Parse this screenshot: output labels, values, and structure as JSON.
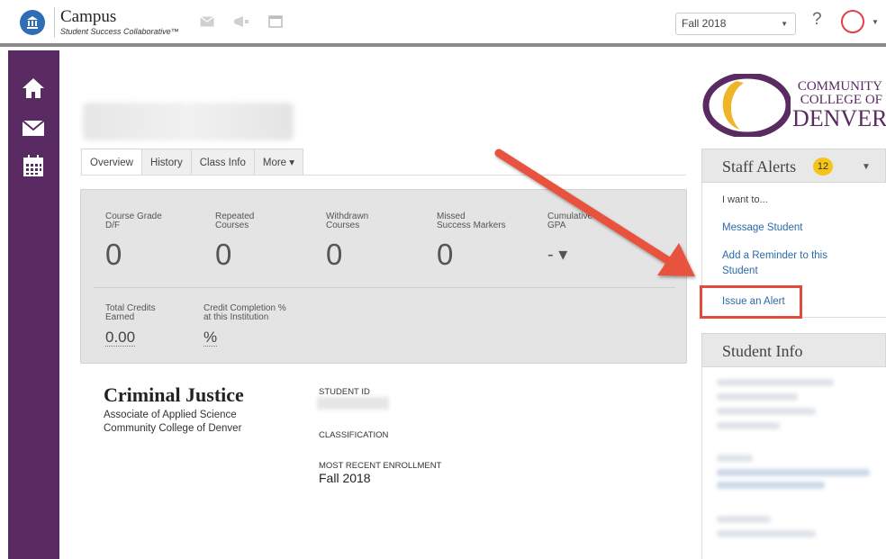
{
  "header": {
    "brand_title": "Campus",
    "brand_subtitle": "Student Success Collaborative™",
    "term_select_value": "Fall 2018",
    "help_label": "?"
  },
  "sidebar": {
    "items": [
      {
        "icon": "home-icon"
      },
      {
        "icon": "mail-icon"
      },
      {
        "icon": "calendar-icon"
      }
    ]
  },
  "tabs": [
    {
      "label": "Overview",
      "active": true
    },
    {
      "label": "History",
      "active": false
    },
    {
      "label": "Class Info",
      "active": false
    },
    {
      "label": "More ▾",
      "active": false
    }
  ],
  "stats": {
    "row1": [
      {
        "label": "Course Grade\nD/F",
        "value": "0"
      },
      {
        "label": "Repeated\nCourses",
        "value": "0"
      },
      {
        "label": "Withdrawn\nCourses",
        "value": "0"
      },
      {
        "label": "Missed\nSuccess Markers",
        "value": "0"
      },
      {
        "label": "Cumulative\nGPA",
        "value": "- ▾"
      }
    ],
    "row2": [
      {
        "label": "Total Credits\nEarned",
        "value": "0.00"
      },
      {
        "label": "Credit Completion %\nat this Institution",
        "value": "%"
      }
    ]
  },
  "program": {
    "title": "Criminal Justice",
    "degree": "Associate of Applied Science",
    "school": "Community College of Denver"
  },
  "student": {
    "id_label": "STUDENT ID",
    "classification_label": "CLASSIFICATION",
    "enrollment_label": "MOST RECENT ENROLLMENT",
    "enrollment_value": "Fall 2018"
  },
  "college_logo": {
    "line1": "COMMUNITY",
    "line2": "COLLEGE OF",
    "line3": "DENVER"
  },
  "staff_alerts": {
    "title": "Staff Alerts",
    "count": "12",
    "intro": "I want to...",
    "actions": [
      {
        "label": "Message Student"
      },
      {
        "label": "Add a Reminder to this Student"
      },
      {
        "label": "Issue an Alert"
      }
    ]
  },
  "student_info": {
    "title": "Student Info"
  },
  "colors": {
    "sidebar": "#5a2b62",
    "link": "#2c6aa7",
    "badge": "#f4c518",
    "highlight": "#e24b3b"
  }
}
